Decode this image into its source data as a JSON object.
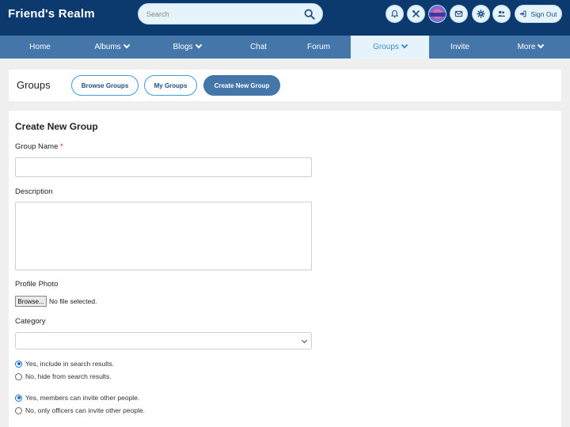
{
  "header": {
    "brand": "Friend's Realm",
    "search_placeholder": "Search",
    "signout_label": "Sign Out",
    "icons": [
      "bell-icon",
      "tools-icon",
      "avatar",
      "envelope-icon",
      "gear-icon",
      "users-icon"
    ]
  },
  "nav": {
    "items": [
      {
        "label": "Home",
        "dropdown": false
      },
      {
        "label": "Albums",
        "dropdown": true
      },
      {
        "label": "Blogs",
        "dropdown": true
      },
      {
        "label": "Chat",
        "dropdown": false
      },
      {
        "label": "Forum",
        "dropdown": false
      },
      {
        "label": "Groups",
        "dropdown": true,
        "active": true
      },
      {
        "label": "Invite",
        "dropdown": false
      },
      {
        "label": "More",
        "dropdown": true
      }
    ]
  },
  "subheader": {
    "title": "Groups",
    "buttons": {
      "browse": "Browse Groups",
      "mine": "My Groups",
      "create": "Create New Group"
    }
  },
  "form": {
    "heading": "Create New Group",
    "group_name_label": "Group Name",
    "required_mark": "*",
    "group_name_value": "",
    "description_label": "Description",
    "description_value": "",
    "profile_photo_label": "Profile Photo",
    "browse_label": "Browse...",
    "file_status": "No file selected.",
    "category_label": "Category",
    "category_selected": "",
    "search_visibility": [
      {
        "label": "Yes, include in search results.",
        "checked": true
      },
      {
        "label": "No, hide from search results.",
        "checked": false
      }
    ],
    "invite_permission": [
      {
        "label": "Yes, members can invite other people.",
        "checked": true
      },
      {
        "label": "No, only officers can invite other people.",
        "checked": false
      }
    ]
  },
  "colors": {
    "header_bg": "#0d3a6e",
    "nav_bg": "#4476a9",
    "nav_active_bg": "#e6f3fb",
    "nav_active_text": "#3f8fcf",
    "pill_border": "#3f9bd6",
    "radio_checked": "#1a6fd1"
  }
}
